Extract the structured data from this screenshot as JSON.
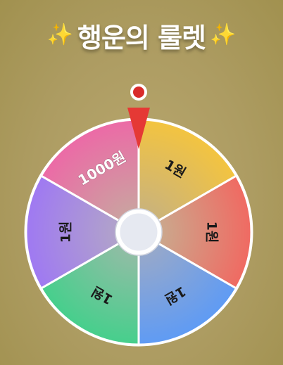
{
  "header": {
    "title": "행운의 룰렛",
    "left_icon": "sparkles-icon",
    "right_icon": "sparkles-icon"
  },
  "pointer": {
    "color": "#e53935",
    "pin_color": "#d32f2f",
    "icon": "pointer-triangle-icon"
  },
  "wheel": {
    "segments": [
      {
        "label": "1000원",
        "colors": [
          "#f3c440",
          "#d5a94b"
        ],
        "rotate": 0
      },
      {
        "label": "1원",
        "colors": [
          "#f0a833",
          "#c9b48a"
        ],
        "rotate": 0
      },
      {
        "label": "1원",
        "colors": [
          "#f06a62",
          "#c9ab8f"
        ],
        "rotate": 0
      },
      {
        "label": "1원",
        "colors": [
          "#5f9bf4",
          "#9aa9c8"
        ],
        "rotate": 0
      },
      {
        "label": "1원",
        "colors": [
          "#46cf8c",
          "#95bca6"
        ],
        "rotate": 0
      },
      {
        "label": "1원",
        "colors": [
          "#9f79f2",
          "#b2a5c8"
        ],
        "rotate": 0
      }
    ],
    "hub_icon": "spin-hub-button"
  }
}
